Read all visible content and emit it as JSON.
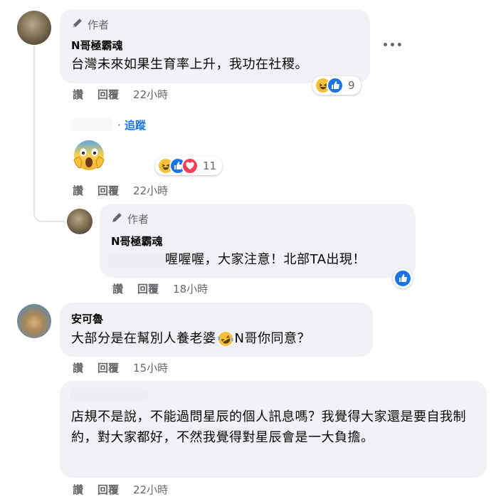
{
  "comments": [
    {
      "author_badge": "作者",
      "name": "N哥極霸魂",
      "text": "台灣未來如果生育率上升，我功在社稷。",
      "reaction_count": "9",
      "actions": {
        "like": "讚",
        "reply": "回覆",
        "time": "22小時"
      }
    },
    {
      "follow_label": "追蹤",
      "reaction_count": "11",
      "actions": {
        "like": "讚",
        "reply": "回覆",
        "time": "22小時"
      }
    },
    {
      "author_badge": "作者",
      "name": "N哥極霸魂",
      "text": "喔喔喔，大家注意！北部TA出現！",
      "actions": {
        "like": "讚",
        "reply": "回覆",
        "time": "18小時"
      }
    },
    {
      "name": "安可魯",
      "text_before": "大部分是在幫別人養老婆",
      "text_after": " N哥你同意？",
      "actions": {
        "like": "讚",
        "reply": "回覆",
        "time": "15小時"
      }
    },
    {
      "text": "店規不是說，不能過問星辰的個人訊息嗎？我覺得大家還是要自我制約，對大家都好，不然我覺得對星辰會是一大負擔。",
      "actions": {
        "like": "讚",
        "reply": "回覆",
        "time": "22小時"
      }
    }
  ],
  "more_options": "•••",
  "follow_dot": "·",
  "colors": {
    "like": "#1b74e4",
    "haha": "#f7c23a",
    "love": "#f33e58",
    "bubble": "#f0f2f5",
    "secondary": "#65676b"
  }
}
